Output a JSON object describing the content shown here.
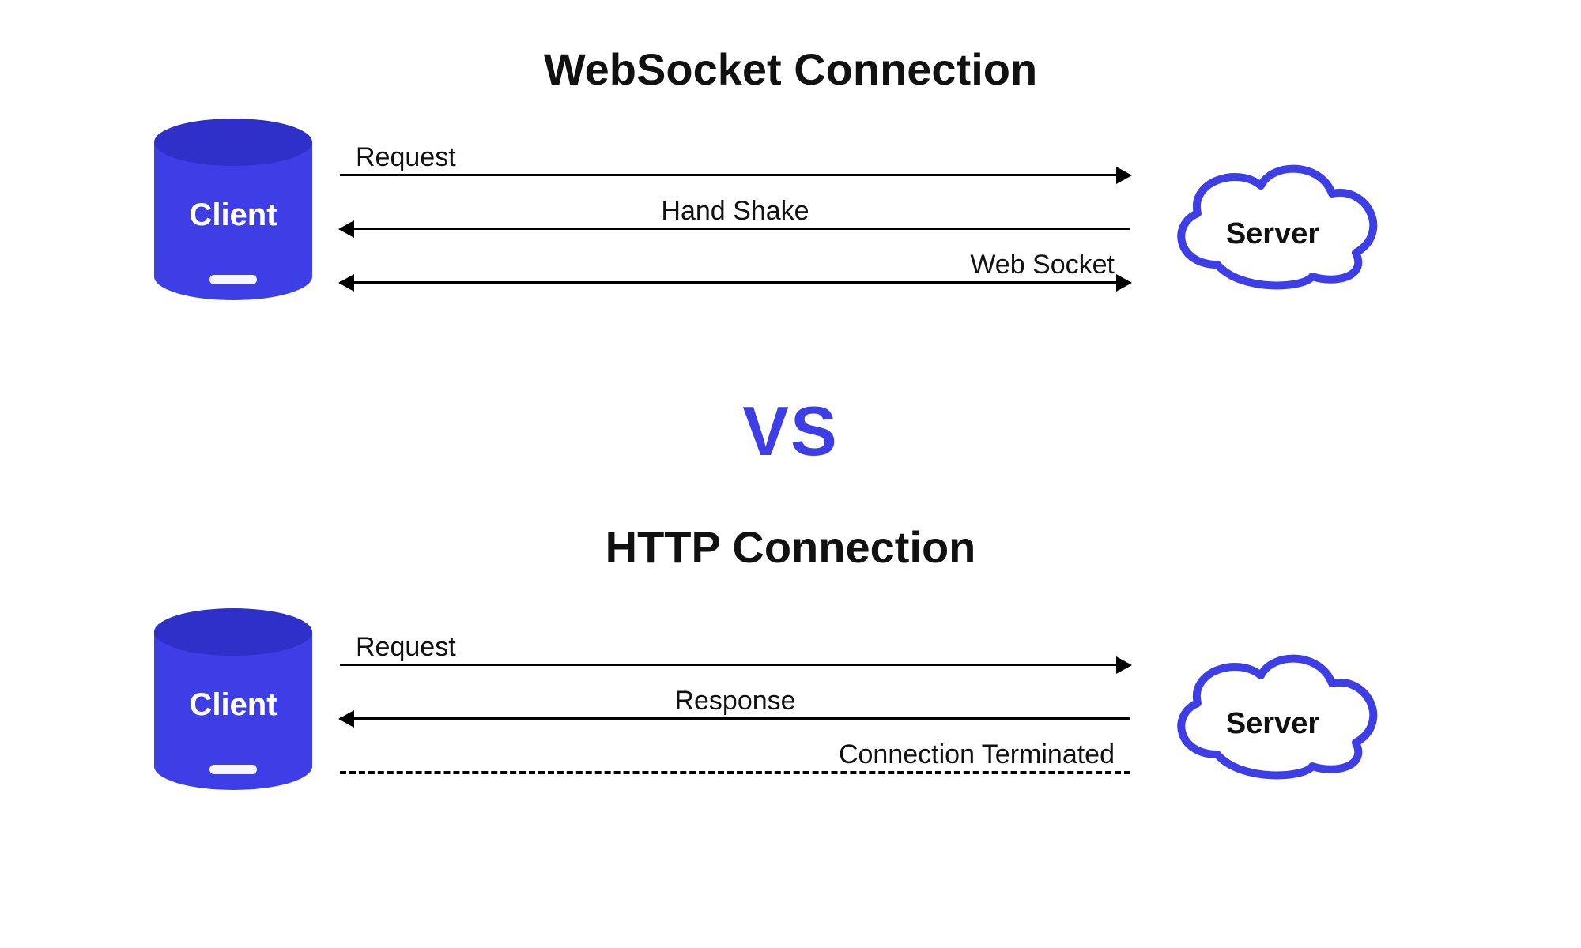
{
  "colors": {
    "accent": "#3d3ee6",
    "text": "#111111",
    "client_top": "#2f30c9"
  },
  "vs_label": "VS",
  "websocket": {
    "title": "WebSocket Connection",
    "client_label": "Client",
    "server_label": "Server",
    "arrows": {
      "request": {
        "label": "Request",
        "direction": "right"
      },
      "handshake": {
        "label": "Hand Shake",
        "direction": "left"
      },
      "websocket": {
        "label": "Web Socket",
        "direction": "both"
      }
    }
  },
  "http": {
    "title": "HTTP Connection",
    "client_label": "Client",
    "server_label": "Server",
    "arrows": {
      "request": {
        "label": "Request",
        "direction": "right"
      },
      "response": {
        "label": "Response",
        "direction": "left"
      },
      "terminated": {
        "label": "Connection Terminated",
        "direction": "none",
        "style": "dashed"
      }
    }
  }
}
